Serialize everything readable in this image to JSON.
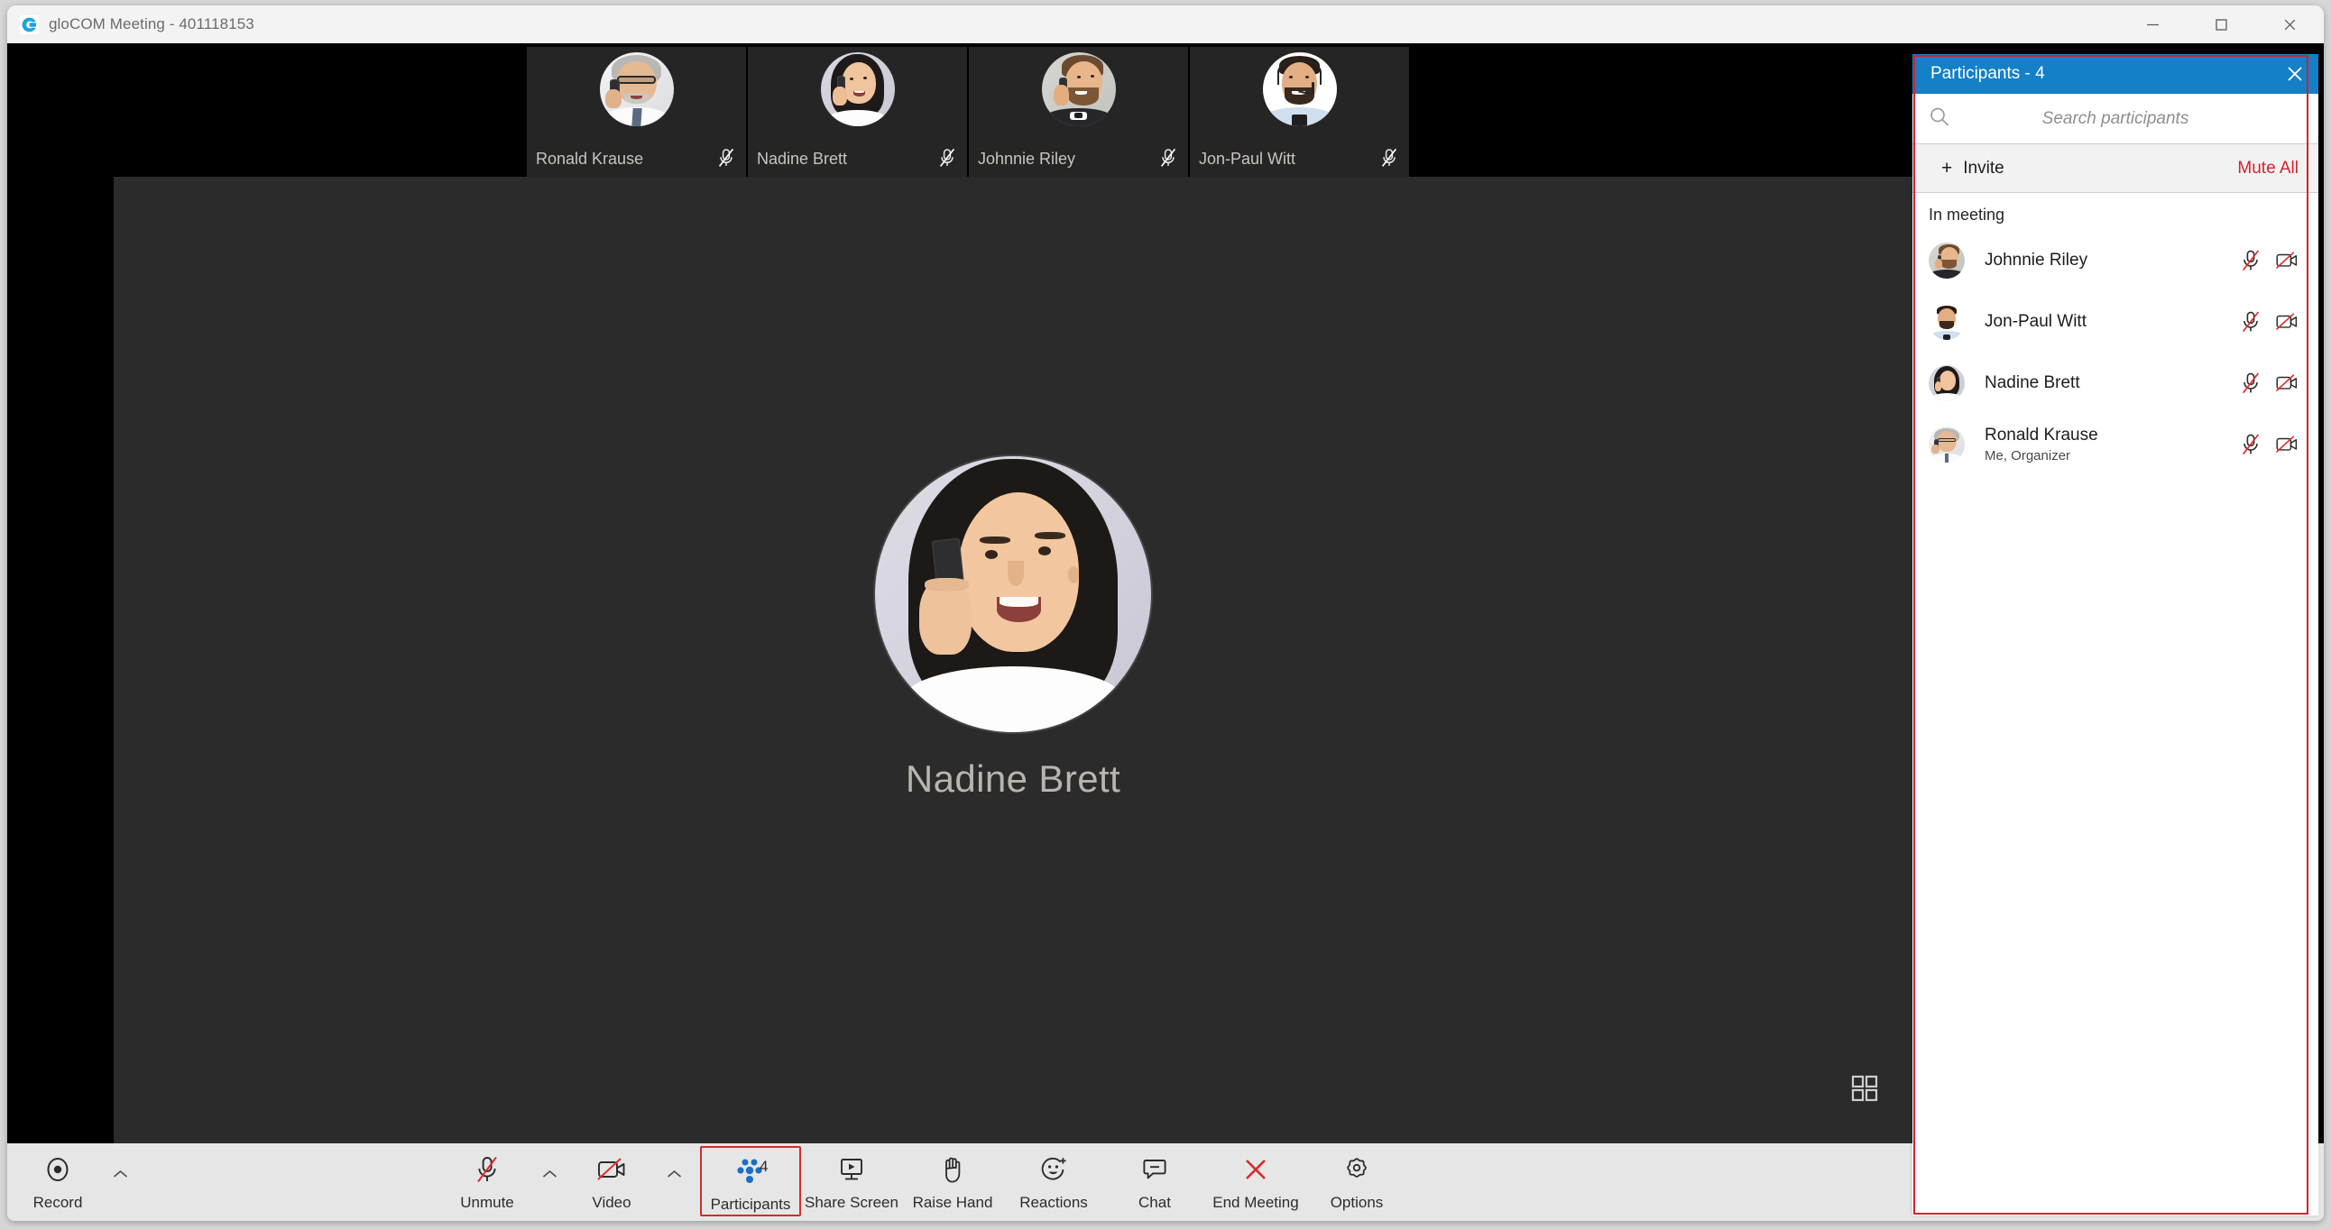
{
  "window": {
    "title": "gloCOM Meeting - 401118153",
    "logo_icon": "glocom-logo-icon",
    "controls": {
      "minimize": "minimize-icon",
      "maximize": "maximize-icon",
      "close": "close-icon"
    }
  },
  "filmstrip": {
    "thumbnails": [
      {
        "name": "Ronald Krause",
        "mic_icon": "mic-off-icon"
      },
      {
        "name": "Nadine Brett",
        "mic_icon": "mic-off-icon"
      },
      {
        "name": "Johnnie Riley",
        "mic_icon": "mic-off-icon"
      },
      {
        "name": "Jon-Paul Witt",
        "mic_icon": "mic-off-icon"
      }
    ]
  },
  "stage": {
    "active_speaker": "Nadine Brett",
    "grid_view_icon": "grid-view-icon"
  },
  "toolbar": {
    "items": [
      {
        "label": "Record",
        "icon": "record-icon",
        "chevron": true,
        "active": false,
        "badge": ""
      },
      {
        "label": "Unmute",
        "icon": "mic-off-icon",
        "chevron": true,
        "active": false,
        "badge": ""
      },
      {
        "label": "Video",
        "icon": "video-off-icon",
        "chevron": true,
        "active": false,
        "badge": ""
      },
      {
        "label": "Participants",
        "icon": "participants-icon",
        "chevron": false,
        "active": true,
        "badge": "4"
      },
      {
        "label": "Share Screen",
        "icon": "share-screen-icon",
        "chevron": false,
        "active": false,
        "badge": ""
      },
      {
        "label": "Raise Hand",
        "icon": "raise-hand-icon",
        "chevron": false,
        "active": false,
        "badge": ""
      },
      {
        "label": "Reactions",
        "icon": "reactions-icon",
        "chevron": false,
        "active": false,
        "badge": ""
      },
      {
        "label": "Chat",
        "icon": "chat-icon",
        "chevron": false,
        "active": false,
        "badge": ""
      },
      {
        "label": "End Meeting",
        "icon": "end-meeting-icon",
        "chevron": false,
        "active": false,
        "badge": ""
      },
      {
        "label": "Options",
        "icon": "gear-icon",
        "chevron": false,
        "active": false,
        "badge": ""
      }
    ]
  },
  "panel": {
    "title": "Participants - 4",
    "close_icon": "close-icon",
    "search": {
      "icon": "search-icon",
      "value": "",
      "placeholder": "Search participants"
    },
    "invite_label": "Invite",
    "invite_plus": "+",
    "mute_all_label": "Mute All",
    "section_label": "In meeting",
    "participants": [
      {
        "name": "Johnnie Riley",
        "sub": "",
        "mic_icon": "mic-off-icon",
        "video_icon": "video-off-icon"
      },
      {
        "name": "Jon-Paul Witt",
        "sub": "",
        "mic_icon": "mic-off-icon",
        "video_icon": "video-off-icon"
      },
      {
        "name": "Nadine Brett",
        "sub": "",
        "mic_icon": "mic-off-icon",
        "video_icon": "video-off-icon"
      },
      {
        "name": "Ronald Krause",
        "sub": "Me, Organizer",
        "mic_icon": "mic-off-icon",
        "video_icon": "video-off-icon"
      }
    ]
  },
  "colors": {
    "panel_header_blue": "#1380c8",
    "highlight_red": "#d91f2e",
    "mute_all_red": "#d6212f",
    "end_meeting_red": "#d32c2c",
    "participants_blue": "#1b6fc4",
    "toolbar_bg": "#e6e6e6",
    "stage_bg": "#2b2b2b"
  }
}
